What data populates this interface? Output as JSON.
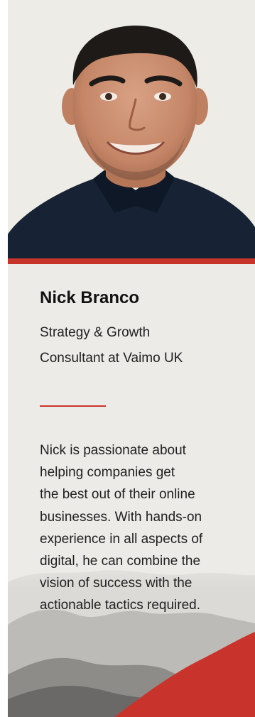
{
  "profile": {
    "name": "Nick Branco",
    "role_lines": [
      "Strategy & Growth",
      "Consultant at Vaimo UK"
    ],
    "bio_lines": [
      "Nick is passionate about",
      "helping companies get",
      "the best out of their online",
      "businesses. With hands-on",
      "experience in all aspects of",
      "digital, he can combine the",
      "vision of success with the",
      "actionable tactics required."
    ]
  },
  "colors": {
    "accent": "#c8342c",
    "card_background": "#ecebe8",
    "shirt": "#172334",
    "hair": "#1d1a17",
    "skin": "#c98f6f"
  },
  "icons": {
    "portrait": "person-portrait",
    "decoration": "mountain-landscape"
  }
}
